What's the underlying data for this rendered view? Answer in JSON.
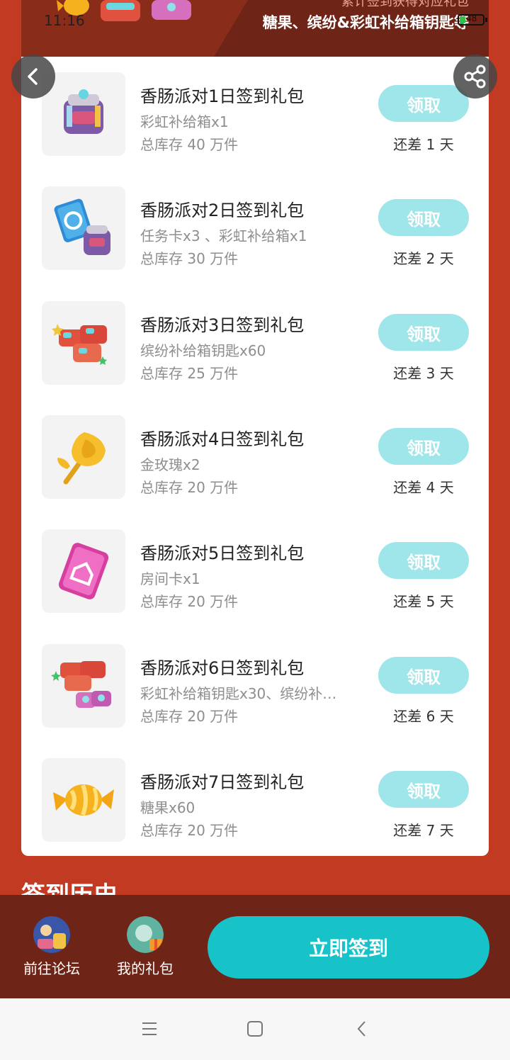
{
  "status_bar": {
    "time": "11:16",
    "battery": "48"
  },
  "banner": {
    "subtitle": "累计签到获得对应礼包",
    "title": "糖果、缤纷&彩虹补给箱钥匙等"
  },
  "icons": {
    "back": "back-arrow-icon",
    "share": "share-icon"
  },
  "gifts": [
    {
      "title": "香肠派对1日签到礼包",
      "desc": "彩虹补给箱x1",
      "stock": "总库存 40 万件",
      "button": "领取",
      "remaining": "还差 1 天",
      "icon": "rainbow-crate-icon"
    },
    {
      "title": "香肠派对2日签到礼包",
      "desc": "任务卡x3 、彩虹补给箱x1",
      "stock": "总库存 30 万件",
      "button": "领取",
      "remaining": "还差 2 天",
      "icon": "mission-card-icon"
    },
    {
      "title": "香肠派对3日签到礼包",
      "desc": "缤纷补给箱钥匙x60",
      "stock": "总库存 25 万件",
      "button": "领取",
      "remaining": "还差 3 天",
      "icon": "colorful-key-icon"
    },
    {
      "title": "香肠派对4日签到礼包",
      "desc": "金玫瑰x2",
      "stock": "总库存 20 万件",
      "button": "领取",
      "remaining": "还差 4 天",
      "icon": "golden-rose-icon"
    },
    {
      "title": "香肠派对5日签到礼包",
      "desc": "房间卡x1",
      "stock": "总库存 20 万件",
      "button": "领取",
      "remaining": "还差 5 天",
      "icon": "room-card-icon"
    },
    {
      "title": "香肠派对6日签到礼包",
      "desc": "彩虹补给箱钥匙x30、缤纷补…",
      "stock": "总库存 20 万件",
      "button": "领取",
      "remaining": "还差 6 天",
      "icon": "key-bundle-icon"
    },
    {
      "title": "香肠派对7日签到礼包",
      "desc": "糖果x60",
      "stock": "总库存 20 万件",
      "button": "领取",
      "remaining": "还差 7 天",
      "icon": "candy-icon"
    }
  ],
  "history_title": "签到历史",
  "bottom_bar": {
    "forum": "前往论坛",
    "my_gifts": "我的礼包",
    "sign_in": "立即签到"
  },
  "colors": {
    "page_bg": "#c23a22",
    "banner_bg": "#6e2416",
    "claim_button": "#9ee6ea",
    "sign_in_button": "#17c3c9"
  }
}
